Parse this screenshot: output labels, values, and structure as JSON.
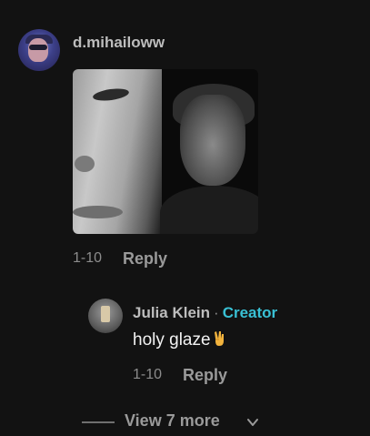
{
  "comment": {
    "username": "d.mihailoww",
    "date": "1-10",
    "reply_label": "Reply"
  },
  "reply": {
    "username": "Julia Klein",
    "separator": "·",
    "badge": "Creator",
    "text": "holy glaze",
    "emoji_icon": "victory-hand-icon",
    "date": "1-10",
    "reply_label": "Reply"
  },
  "view_more": {
    "label": "View 7 more"
  },
  "colors": {
    "background": "#121212",
    "creator_accent": "#39c0d4",
    "muted_text": "#8c8c8c"
  }
}
